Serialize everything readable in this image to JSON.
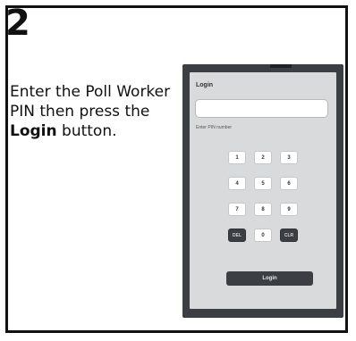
{
  "step": {
    "number": "2"
  },
  "instruction": {
    "text_before": "Enter the Poll Worker PIN then press the ",
    "bold": "Login",
    "text_after": " button."
  },
  "login_screen": {
    "title": "Login",
    "pin_input_value": "",
    "hint": "Enter PIN number",
    "keys": {
      "k1": "1",
      "k2": "2",
      "k3": "3",
      "k4": "4",
      "k5": "5",
      "k6": "6",
      "k7": "7",
      "k8": "8",
      "k9": "9",
      "del": "DEL",
      "k0": "0",
      "clr": "CLR"
    },
    "login_button": "Login"
  }
}
